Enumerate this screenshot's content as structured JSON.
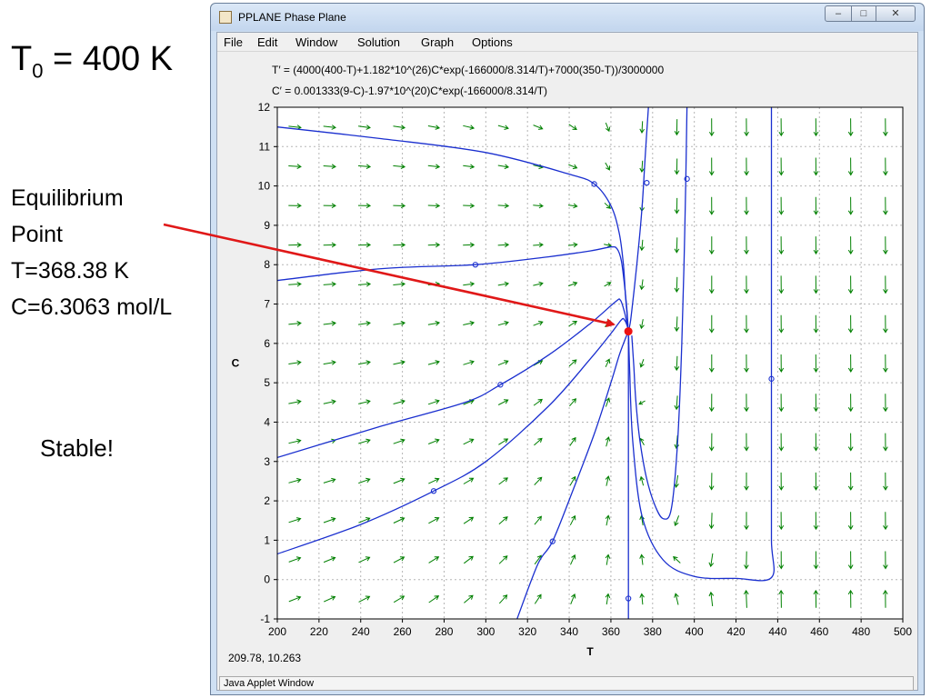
{
  "slide": {
    "t0_main": "T",
    "t0_sub": "0",
    "t0_rest": " = 400 K",
    "eq_line1": "Equilibrium",
    "eq_line2": "Point",
    "eq_line3": "T=368.38 K",
    "eq_line4": "C=6.3063 mol/L",
    "stable": "Stable!"
  },
  "window": {
    "title": "PPLANE Phase Plane",
    "menu": [
      "File",
      "Edit",
      "Window",
      "Solution",
      "Graph",
      "Options"
    ],
    "status": "Java Applet Window",
    "coord_readout": "209.78,  10.263"
  },
  "equations": {
    "t_prime": "T′ = (4000(400-T)+1.182*10^(26)C*exp(-166000/8.314/T)+7000(350-T))/3000000",
    "c_prime": "C′ = 0.001333(9-C)-1.97*10^(20)C*exp(-166000/8.314/T)"
  },
  "colors": {
    "trajectory": "#1a2fcf",
    "field": "#008000",
    "grid": "#b5b5b5",
    "equilibrium": "#ee1111",
    "arrow": "#e01818"
  },
  "chart_data": {
    "type": "line",
    "xlabel": "T",
    "ylabel": "C",
    "xlim": [
      200,
      500
    ],
    "ylim": [
      -1,
      12
    ],
    "xticks": [
      200,
      220,
      240,
      260,
      280,
      300,
      320,
      340,
      360,
      380,
      400,
      420,
      440,
      460,
      480,
      500
    ],
    "yticks": [
      -1,
      0,
      1,
      2,
      3,
      4,
      5,
      6,
      7,
      8,
      9,
      10,
      11,
      12
    ],
    "grid": true,
    "equilibrium": {
      "T": 368.38,
      "C": 6.3063
    },
    "series": [
      {
        "points": [
          [
            200,
            11.5
          ],
          [
            250,
            11.2
          ],
          [
            300,
            10.85
          ],
          [
            340,
            10.3
          ],
          [
            352,
            10.05
          ],
          [
            360,
            9.5
          ],
          [
            364,
            8.8
          ],
          [
            366,
            8.0
          ],
          [
            367,
            7.2
          ],
          [
            367.8,
            6.7
          ],
          [
            368.2,
            6.4
          ]
        ],
        "markers": [
          [
            352,
            10.05
          ]
        ]
      },
      {
        "points": [
          [
            200,
            7.6
          ],
          [
            250,
            7.9
          ],
          [
            295,
            8.0
          ],
          [
            330,
            8.2
          ],
          [
            350,
            8.35
          ],
          [
            360,
            8.45
          ],
          [
            363,
            8.4
          ],
          [
            365,
            8.1
          ],
          [
            366.5,
            7.5
          ],
          [
            367.6,
            6.9
          ],
          [
            368.2,
            6.45
          ]
        ],
        "markers": [
          [
            295,
            8.0
          ]
        ]
      },
      {
        "points": [
          [
            200,
            3.1
          ],
          [
            250,
            3.9
          ],
          [
            290,
            4.5
          ],
          [
            307,
            4.95
          ],
          [
            330,
            5.7
          ],
          [
            350,
            6.5
          ],
          [
            362,
            7.05
          ],
          [
            364.5,
            7.1
          ],
          [
            366.5,
            6.8
          ],
          [
            367.7,
            6.5
          ],
          [
            368.3,
            6.35
          ]
        ],
        "markers": [
          [
            307,
            4.95
          ]
        ]
      },
      {
        "points": [
          [
            200,
            0.65
          ],
          [
            240,
            1.4
          ],
          [
            275,
            2.25
          ],
          [
            300,
            3.0
          ],
          [
            330,
            4.4
          ],
          [
            350,
            5.6
          ],
          [
            360,
            6.25
          ],
          [
            365,
            6.6
          ],
          [
            366.5,
            6.6
          ],
          [
            367.8,
            6.45
          ],
          [
            368.3,
            6.33
          ]
        ],
        "markers": [
          [
            275,
            2.25
          ]
        ]
      },
      {
        "points": [
          [
            315,
            -1.0
          ],
          [
            325,
            0.4
          ],
          [
            332,
            0.97
          ],
          [
            342,
            2.3
          ],
          [
            352,
            3.7
          ],
          [
            360,
            5.0
          ],
          [
            364,
            5.7
          ],
          [
            366.8,
            6.1
          ],
          [
            368.2,
            6.28
          ]
        ],
        "markers": [
          [
            332,
            0.97
          ]
        ]
      },
      {
        "points": [
          [
            368.38,
            -1.0
          ],
          [
            368.38,
            -0.48
          ],
          [
            368.38,
            2.0
          ],
          [
            368.38,
            4.5
          ],
          [
            368.38,
            6.3063
          ]
        ],
        "markers": [
          [
            368.38,
            -0.48
          ]
        ]
      },
      {
        "points": [
          [
            378,
            12.0
          ],
          [
            376.5,
            10.8
          ],
          [
            375,
            9.5
          ],
          [
            373,
            8.3
          ],
          [
            371,
            7.3
          ],
          [
            369.5,
            6.6
          ],
          [
            368.6,
            6.35
          ]
        ],
        "markers": [
          [
            377.2,
            10.08
          ]
        ]
      },
      {
        "points": [
          [
            370,
            6.2
          ],
          [
            371,
            5.4
          ],
          [
            372,
            4.5
          ],
          [
            374,
            3.5
          ],
          [
            377,
            2.6
          ],
          [
            381,
            1.9
          ],
          [
            385,
            1.55
          ],
          [
            389,
            1.8
          ],
          [
            392,
            3.5
          ],
          [
            394,
            6.0
          ],
          [
            395.5,
            9.0
          ],
          [
            396.5,
            12.0
          ]
        ],
        "markers": [
          [
            396.5,
            10.18
          ]
        ]
      },
      {
        "points": [
          [
            437,
            12.0
          ],
          [
            437,
            10.0
          ],
          [
            437,
            7.0
          ],
          [
            437,
            5.1
          ],
          [
            437,
            3.0
          ],
          [
            437,
            1.0
          ],
          [
            437,
            0.05
          ],
          [
            420,
            0.03
          ],
          [
            400,
            0.08
          ],
          [
            385,
            0.5
          ],
          [
            375,
            1.6
          ],
          [
            370.5,
            3.5
          ],
          [
            369,
            5.3
          ],
          [
            368.5,
            6.2
          ]
        ],
        "markers": [
          [
            437,
            5.1
          ]
        ]
      }
    ]
  }
}
